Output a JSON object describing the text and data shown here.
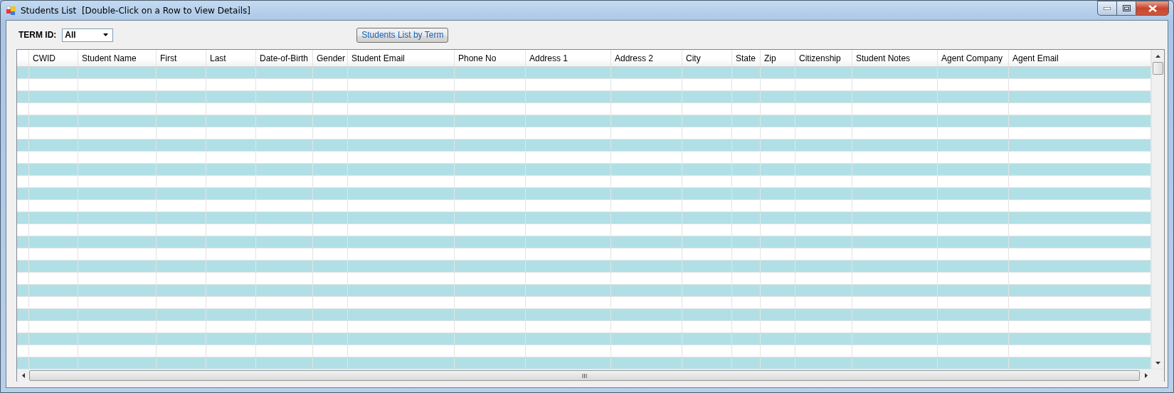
{
  "window": {
    "title": "Students List  [Double-Click on a Row to View Details]"
  },
  "filter": {
    "label": "TERM ID:",
    "value": "All"
  },
  "button": {
    "label": "Students List by Term"
  },
  "table": {
    "columns": [
      "CWID",
      "Student Name",
      "First",
      "Last",
      "Date-of-Birth",
      "Gender",
      "Student Email",
      "Phone No",
      "Address 1",
      "Address 2",
      "City",
      "State",
      "Zip",
      "Citizenship",
      "Student Notes",
      "Agent Company",
      "Agent Email"
    ]
  }
}
